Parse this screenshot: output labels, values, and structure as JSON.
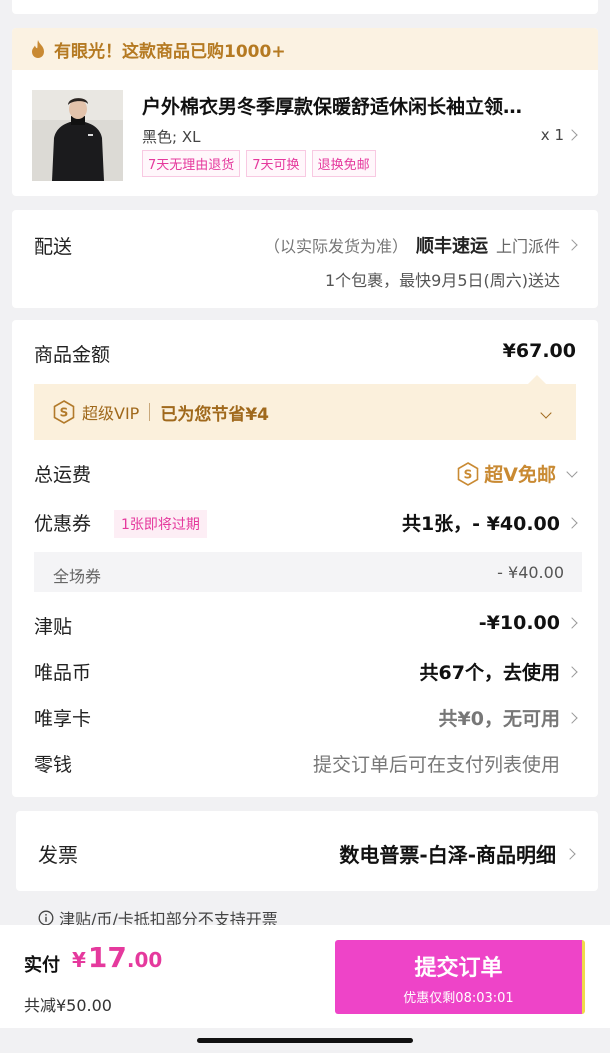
{
  "promo": {
    "text": "有眼光！这款商品已购1000+",
    "icon": "flame-icon",
    "color": "#b57a22"
  },
  "product": {
    "image": "product-photo-black-jacket",
    "title": "户外棉衣男冬季厚款保暖舒适休闲长袖立领…",
    "spec": "黑色; XL",
    "qty": "x 1",
    "tags": [
      "7天无理由退货",
      "7天可换",
      "退换免邮"
    ]
  },
  "shipping": {
    "label": "配送",
    "note": "（以实际发货为准）",
    "carrier": "顺丰速运",
    "method": "上门派件",
    "eta": "1个包裹，最快9月5日(周六)送达"
  },
  "summary": {
    "goods_label": "商品金额",
    "goods_value": "¥67.00",
    "vip": {
      "name": "超级VIP",
      "save": "已为您节省¥4",
      "icon": "vip-s-icon"
    },
    "freight_label": "总运费",
    "freight_value": "超V免邮",
    "coupon_label": "优惠券",
    "coupon_badge": "1张即将过期",
    "coupon_value": "共1张，- ¥40.00",
    "coupon_detail_label": "全场券",
    "coupon_detail_value": "- ¥40.00",
    "subsidy_label": "津贴",
    "subsidy_value": "-¥10.00",
    "coin_label": "唯品币",
    "coin_value": "共67个，去使用",
    "card_label": "唯享卡",
    "card_value": "共¥0，无可用",
    "change_label": "零钱",
    "change_value": "提交订单后可在支付列表使用"
  },
  "invoice": {
    "label": "发票",
    "value": "数电普票-白泽-商品明细",
    "note": "津贴/币/卡抵扣部分不支持开票"
  },
  "bottom": {
    "pay_label": "实付",
    "currency": "¥",
    "amount_int": "17",
    "amount_dec": ".00",
    "saved": "共减¥50.00",
    "submit": "提交订单",
    "countdown": "优惠仅剩08:03:01",
    "accent": "#ee44c8"
  }
}
